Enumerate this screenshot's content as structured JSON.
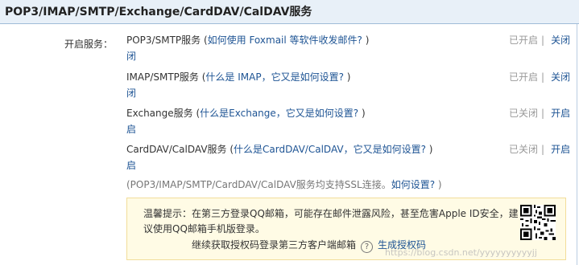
{
  "header": {
    "title": "POP3/IMAP/SMTP/Exchange/CardDAV/CalDAV服务"
  },
  "label_open_services": "开启服务：",
  "services": [
    {
      "name": "POP3/SMTP服务",
      "paren_open": " (",
      "link": "如何使用 Foxmail 等软件收发邮件?",
      "paren_close": " )",
      "status": "已开启",
      "separator": "|",
      "action": "关闭",
      "action_wrap": "闭"
    },
    {
      "name": "IMAP/SMTP服务",
      "paren_open": " (",
      "link": "什么是 IMAP，它又是如何设置?",
      "paren_close": " )",
      "status": "已开启",
      "separator": "|",
      "action": "关闭",
      "action_wrap": "闭"
    },
    {
      "name": "Exchange服务",
      "paren_open": " (",
      "link": "什么是Exchange，它又是如何设置?",
      "paren_close": " )",
      "status": "已关闭",
      "separator": "|",
      "action": "开启",
      "action_wrap": "启"
    },
    {
      "name": "CardDAV/CalDAV服务",
      "paren_open": " (",
      "link": "什么是CardDAV/CalDAV，它又是如何设置?",
      "paren_close": " )",
      "status": "已关闭",
      "separator": "|",
      "action": "开启",
      "action_wrap": "启"
    }
  ],
  "ssl_note": {
    "text": "(POP3/IMAP/SMTP/CardDAV/CalDAV服务均支持SSL连接。",
    "link": "如何设置?",
    "close": " )"
  },
  "tip": {
    "text": "温馨提示：在第三方登录QQ邮箱，可能存在邮件泄露风险，甚至危害Apple ID安全，建议使用QQ邮箱手机版登录。",
    "action_text": "继续获取授权码登录第三方客户端邮箱",
    "help_icon": "?",
    "generate_link": "生成授权码"
  },
  "watermark": "https://blog.csdn.net/yyyyyyyyyyjj"
}
